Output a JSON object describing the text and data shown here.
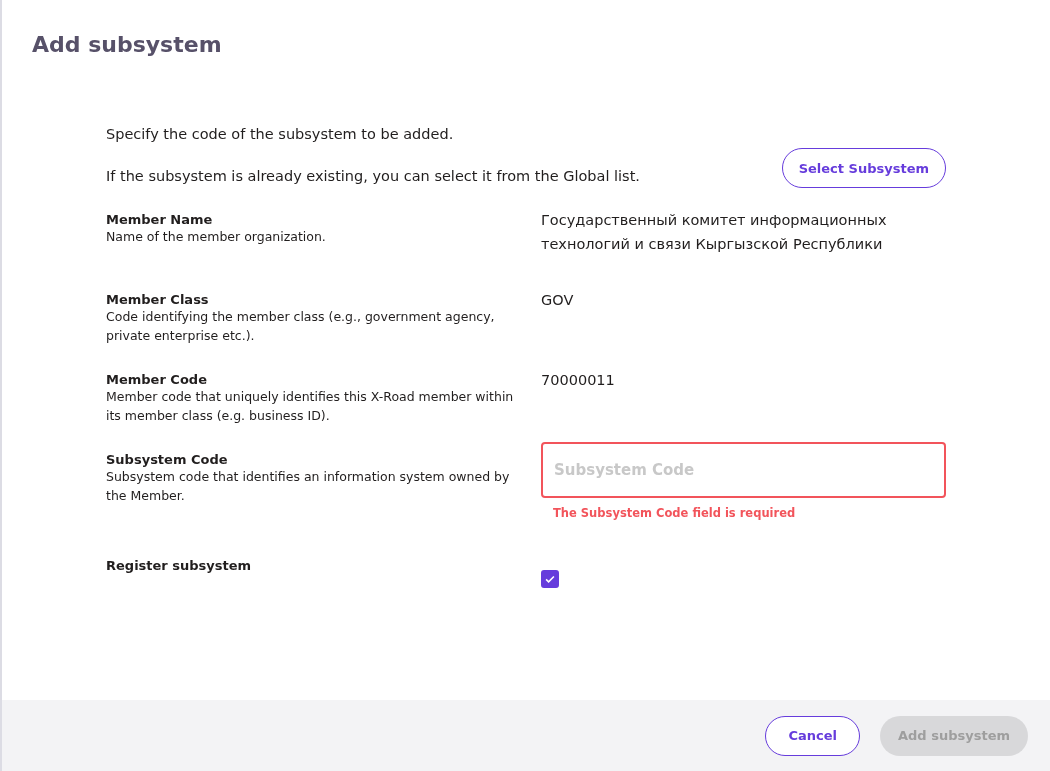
{
  "title": "Add subsystem",
  "intro": [
    "Specify the code of the subsystem to be added.",
    "If the subsystem is already existing, you can select it from the Global list."
  ],
  "select_button": "Select Subsystem",
  "fields": [
    {
      "kind": "text",
      "label": "Member Name",
      "help": "Name of the member organization.",
      "value": "Государственный комитет информационных технологий и связи Кыргызской Республики"
    },
    {
      "kind": "text",
      "label": "Member Class",
      "help": "Code identifying the member class (e.g., government agency, private enterprise etc.).",
      "value": "GOV"
    },
    {
      "kind": "text",
      "label": "Member Code",
      "help": "Member code that uniquely identifies this X-Road member within its member class (e.g. business ID).",
      "value": "70000011"
    },
    {
      "kind": "input",
      "label": "Subsystem Code",
      "help": "Subsystem code that identifies an information system owned by the Member.",
      "placeholder": "Subsystem Code",
      "error": "The Subsystem Code field is required"
    },
    {
      "kind": "checkbox",
      "label": "Register subsystem",
      "checked": true
    }
  ],
  "buttons": [
    {
      "label": "Cancel",
      "disabled": false
    },
    {
      "label": "Add subsystem",
      "disabled": true
    }
  ]
}
